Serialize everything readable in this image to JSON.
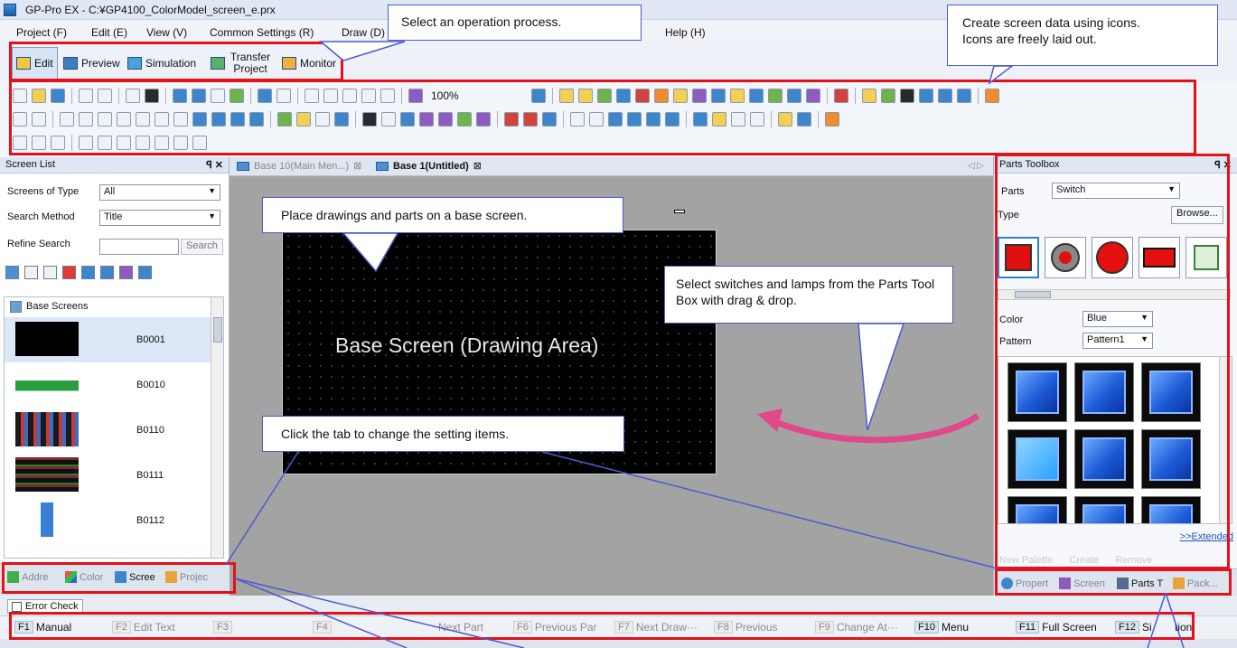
{
  "window": {
    "title": "GP-Pro EX - C:¥GP4100_ColorModel_screen_e.prx"
  },
  "menu": [
    "Project (F)",
    "Edit (E)",
    "View (V)",
    "Common Settings (R)",
    "Draw (D)",
    "Help (H)"
  ],
  "modes": [
    {
      "label": "Edit",
      "selected": true
    },
    {
      "label": "Preview"
    },
    {
      "label": "Simulation"
    },
    {
      "label": "Transfer Project"
    },
    {
      "label": "Monitor"
    }
  ],
  "toolbar": {
    "zoom": "100%"
  },
  "screen_list": {
    "title": "Screen List",
    "screens_of_type_label": "Screens of Type",
    "screens_of_type_value": "All",
    "search_method_label": "Search Method",
    "search_method_value": "Title",
    "refine_label": "Refine Search",
    "search_button": "Search",
    "group": "Base Screens",
    "items": [
      "B0001",
      "B0010",
      "B0110",
      "B0111",
      "B0112"
    ]
  },
  "left_tabs": [
    "Addre",
    "Color",
    "Scree",
    "Projec"
  ],
  "doc_tabs": [
    {
      "label": "Base 10(Main Men...)",
      "active": false
    },
    {
      "label": "Base 1(Untitled)",
      "active": true
    }
  ],
  "canvas": {
    "caption": "Base Screen (Drawing Area)"
  },
  "parts_toolbox": {
    "title": "Parts Toolbox",
    "parts_label": "Parts",
    "parts_value": "Switch",
    "type_label": "Type",
    "browse": "Browse...",
    "color_label": "Color",
    "color_value": "Blue",
    "pattern_label": "Pattern",
    "pattern_value": "Pattern1",
    "extended": ">>Extended",
    "footer_items": [
      "New Palette",
      "Create",
      "Remove"
    ]
  },
  "right_tabs": [
    "Propert",
    "Screen",
    "Parts T",
    "Pack..."
  ],
  "error_check": "Error Check",
  "fkeys": [
    {
      "key": "F1",
      "label": "Manual"
    },
    {
      "key": "F2",
      "label": "Edit Text"
    },
    {
      "key": "F3",
      "label": ""
    },
    {
      "key": "F4",
      "label": ""
    },
    {
      "key": "",
      "label": "Next Part"
    },
    {
      "key": "F6",
      "label": "Previous Par"
    },
    {
      "key": "F7",
      "label": "Next Draw···"
    },
    {
      "key": "F8",
      "label": "Previous"
    },
    {
      "key": "F9",
      "label": "Change At···"
    },
    {
      "key": "F10",
      "label": "Menu"
    },
    {
      "key": "F11",
      "label": "Full Screen"
    },
    {
      "key": "F12",
      "label": "Si"
    },
    {
      "key": "",
      "label": "tion"
    }
  ],
  "callouts": {
    "operation": "Select an operation process.",
    "icons": "Create screen data using icons.\nIcons are freely laid out.",
    "base": "Place drawings and parts on a base screen.",
    "toolbox": "Select switches and lamps from the Parts Tool Box with drag & drop.",
    "tab": "Click the tab to change the setting items."
  },
  "colors": {
    "highlight": "#e3121a",
    "callout_border": "#4d5ad0"
  }
}
